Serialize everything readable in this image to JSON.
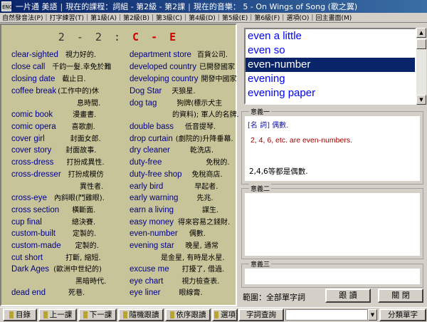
{
  "titlebar": {
    "app": "一片通 美語",
    "course": "現在的課程：詞組 - 第2級 - 第2課",
    "music": "現在的音樂：  5 - On Wings of Song (歌之翼)",
    "icon": "app-icon"
  },
  "menu": [
    "自然發音法(P)",
    "打字練習(T)",
    "第1級(A)",
    "第2級(B)",
    "第3級(C)",
    "第4級(D)",
    "第5級(E)",
    "第6級(F)",
    "選項(O)",
    "回主畫面(M)"
  ],
  "lesson": {
    "number": "2 - 2 :",
    "range": "C - E"
  },
  "left_entries": [
    {
      "w": "clear-sighted",
      "c": "視力好的."
    },
    {
      "w": "close call",
      "c": "千鈞一髮.幸免於難"
    },
    {
      "w": "closing date",
      "c": "截止日."
    },
    {
      "w": "coffee break",
      "c": "(工作中的)休"
    },
    {
      "w": "comic book",
      "c": "漫畫書."
    },
    {
      "w": "comic opera",
      "c": "喜歌劇."
    },
    {
      "w": "cover girl",
      "c": "封面女郎."
    },
    {
      "w": "cover story",
      "c": "封面故事."
    },
    {
      "w": "cross-dress",
      "c": "打扮成異性."
    },
    {
      "w": "cross-dresser",
      "c": "打扮成模仿"
    },
    {
      "w": "cross-eye",
      "c": "內斜眼(鬥雞眼)."
    },
    {
      "w": "cross section",
      "c": "橫斷面."
    },
    {
      "w": "cup final",
      "c": "總決賽."
    },
    {
      "w": "custom-built",
      "c": "定製的."
    },
    {
      "w": "custom-made",
      "c": "定製的."
    },
    {
      "w": "cut short",
      "c": "打斷, 縮短."
    },
    {
      "w": "Dark Ages",
      "c": "(歐洲中世紀的)"
    },
    {
      "w": "dead end",
      "c": "死巷."
    }
  ],
  "left_continuations": [
    "息時間.",
    "異性者.",
    "黑暗時代."
  ],
  "right_entries": [
    {
      "w": "department store",
      "c": "百貨公司."
    },
    {
      "w": "developed country",
      "c": "已開發國家"
    },
    {
      "w": "developing country",
      "c": "開發中國家"
    },
    {
      "w": "Dog Star",
      "c": "天狼星."
    },
    {
      "w": "dog tag",
      "c": "狗牌(標示犬主"
    },
    {
      "w": "double bass",
      "c": "低音提琴."
    },
    {
      "w": "drop curtain",
      "c": "(劇院的)升降垂幕."
    },
    {
      "w": "dry cleaner",
      "c": "乾洗店."
    },
    {
      "w": "duty-free",
      "c": "免稅的."
    },
    {
      "w": "duty-free shop",
      "c": "免稅商店."
    },
    {
      "w": "early bird",
      "c": "早起者."
    },
    {
      "w": "early warning",
      "c": "先兆."
    },
    {
      "w": "earn a living",
      "c": "謀生."
    },
    {
      "w": "easy money",
      "c": "得來容易之錢財."
    },
    {
      "w": "even-number",
      "c": "偶數."
    },
    {
      "w": "evening star",
      "c": "晚星, 通常"
    },
    {
      "w": "excuse me",
      "c": "打擾了, 借過."
    },
    {
      "w": "eye chart",
      "c": "視力檢查表."
    },
    {
      "w": "eye liner",
      "c": "眼線膏."
    }
  ],
  "right_continuations": [
    "的資料); 軍人的名牌.",
    "是金星, 有時是水星."
  ],
  "word_list": {
    "items": [
      "even a little",
      "even so",
      "even-number",
      "evening",
      "evening paper"
    ],
    "selected": 2
  },
  "meaning1": {
    "label": "意義一",
    "pos": "[名    詞] 偶數.",
    "example_en": "2, 4, 6, etc. are even-numbers.",
    "example_zh": "2,4,6等都是偶數."
  },
  "meaning2": {
    "label": "意義二"
  },
  "meaning3": {
    "label": "意義三"
  },
  "range_label": "範圍：全部單字詞",
  "buttons": {
    "follow": "跟  讀",
    "close": "關  閉"
  },
  "toolbar": [
    "目錄",
    "上一課",
    "下一課",
    "隨機跟讀",
    "依序跟讀",
    "選項"
  ],
  "query": {
    "label": "字詞查詢",
    "value": ""
  },
  "classify": "分類單字",
  "colors": {
    "panel": "#c8c499",
    "word": "#00008b",
    "accent": "#d40000",
    "selection": "#0a246a"
  }
}
